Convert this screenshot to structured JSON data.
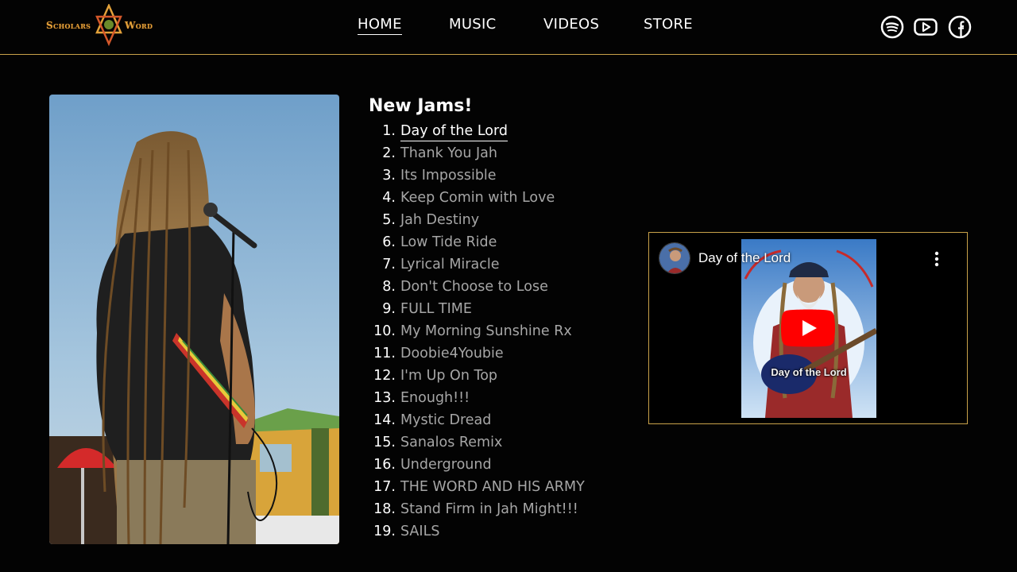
{
  "header": {
    "logo": {
      "left_text": "Scholars",
      "right_text": "Word"
    },
    "nav": [
      {
        "label": "HOME",
        "active": true
      },
      {
        "label": "MUSIC",
        "active": false
      },
      {
        "label": "VIDEOS",
        "active": false
      },
      {
        "label": "STORE",
        "active": false
      }
    ],
    "social": [
      {
        "icon": "spotify-icon"
      },
      {
        "icon": "youtube-icon"
      },
      {
        "icon": "facebook-icon"
      }
    ]
  },
  "main": {
    "photo": {
      "subject": "musician-with-dreadlocks-at-microphone"
    },
    "jams": {
      "title": "New Jams!",
      "tracks": [
        {
          "num": "1.",
          "title": "Day of the Lord",
          "active": true
        },
        {
          "num": "2.",
          "title": "Thank You Jah"
        },
        {
          "num": "3.",
          "title": "Its Impossible"
        },
        {
          "num": "4.",
          "title": "Keep Comin with Love"
        },
        {
          "num": "5.",
          "title": "Jah Destiny"
        },
        {
          "num": "6.",
          "title": "Low Tide Ride"
        },
        {
          "num": "7.",
          "title": "Lyrical Miracle"
        },
        {
          "num": "8.",
          "title": "Don't Choose to Lose"
        },
        {
          "num": "9.",
          "title": "FULL TIME"
        },
        {
          "num": "10.",
          "title": "My Morning Sunshine Rx"
        },
        {
          "num": "11.",
          "title": "Doobie4Youbie"
        },
        {
          "num": "12.",
          "title": "I'm Up On Top"
        },
        {
          "num": "13.",
          "title": "Enough!!!"
        },
        {
          "num": "14.",
          "title": "Mystic Dread"
        },
        {
          "num": "15.",
          "title": "Sanalos Remix"
        },
        {
          "num": "16.",
          "title": "Underground"
        },
        {
          "num": "17.",
          "title": "THE WORD AND HIS ARMY"
        },
        {
          "num": "18.",
          "title": "Stand Firm in Jah Might!!!"
        },
        {
          "num": "19.",
          "title": "SAILS"
        }
      ]
    },
    "video": {
      "title": "Day of the Lord",
      "thumbnail_caption": "Day of the Lord"
    }
  },
  "colors": {
    "background": "#030303",
    "accent_gold": "#c9a24a",
    "inactive_text": "#a6a6a6",
    "youtube_red": "#ff0000"
  }
}
